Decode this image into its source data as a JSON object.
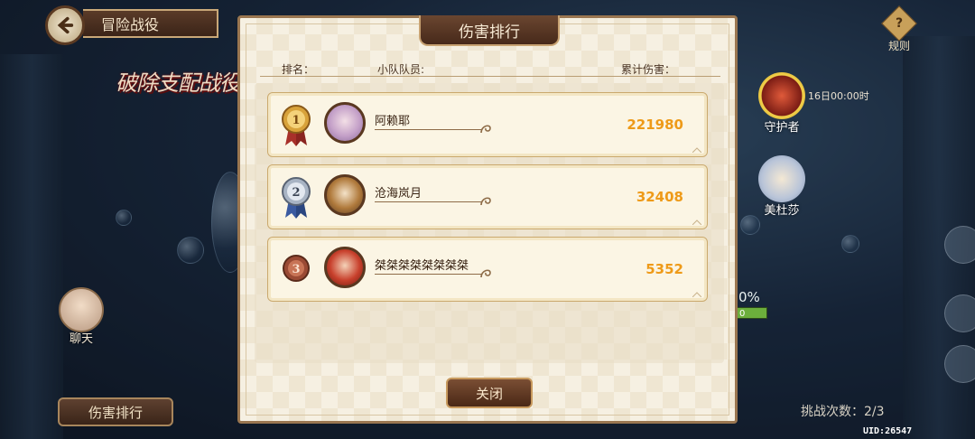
{
  "top_left": {
    "title": "冒险战役",
    "logo_text": "破除支配战役"
  },
  "left": {
    "chat_label": "聊天",
    "rank_button_label": "伤害排行"
  },
  "right": {
    "rules_label": "规则",
    "time_text": "16日00:00时",
    "bosses": [
      {
        "name": "守护者"
      },
      {
        "name": "美杜莎"
      }
    ],
    "percent": "0%",
    "bar_text": "0",
    "challenge_label": "挑战次数：",
    "challenge_value": "2/3",
    "uid": "UID:26547"
  },
  "modal": {
    "title": "伤害排行",
    "header": {
      "rank": "排名：",
      "member": "小队队员:",
      "damage": "累计伤害："
    },
    "rows": [
      {
        "rank": "1",
        "name": "阿赖耶",
        "damage": "221980"
      },
      {
        "rank": "2",
        "name": "沧海岚月",
        "damage": "32408"
      },
      {
        "rank": "3",
        "name": "桀桀桀桀桀桀桀桀",
        "damage": "5352"
      }
    ],
    "close_label": "关闭"
  },
  "colors": {
    "damage": "#ee9a18",
    "panel": "#f6f0e2",
    "frame": "#9a7650"
  }
}
